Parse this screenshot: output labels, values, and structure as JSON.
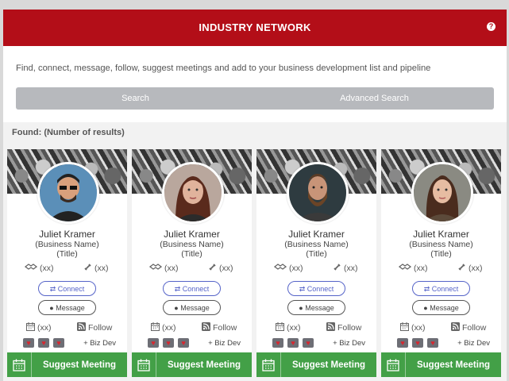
{
  "header": {
    "title": "INDUSTRY NETWORK"
  },
  "intro": {
    "description": "Find, connect, message, follow, suggest meetings and add to your business development list and pipeline",
    "search_label": "Search",
    "advanced_search_label": "Advanced Search"
  },
  "results": {
    "found_label": "Found: (Number of results)"
  },
  "cards": [
    {
      "name": "Juliet Kramer",
      "business": "(Business Name)",
      "title": "(Title)",
      "handshake_count": "(xx)",
      "link_count": "(xx)",
      "connect_label": "Connect",
      "message_label": "Message",
      "calendar_count": "(xx)",
      "follow_label": "Follow",
      "bizdev_label": "+ Biz Dev",
      "suggest_label": "Suggest Meeting"
    },
    {
      "name": "Juliet Kramer",
      "business": "(Business Name)",
      "title": "(Title)",
      "handshake_count": "(xx)",
      "link_count": "(xx)",
      "connect_label": "Connect",
      "message_label": "Message",
      "calendar_count": "(xx)",
      "follow_label": "Follow",
      "bizdev_label": "+ Biz Dev",
      "suggest_label": "Suggest Meeting"
    },
    {
      "name": "Juliet Kramer",
      "business": "(Business Name)",
      "title": "(Title)",
      "handshake_count": "(xx)",
      "link_count": "(xx)",
      "connect_label": "Connect",
      "message_label": "Message",
      "calendar_count": "(xx)",
      "follow_label": "Follow",
      "bizdev_label": "+ Biz Dev",
      "suggest_label": "Suggest Meeting"
    },
    {
      "name": "Juliet Kramer",
      "business": "(Business Name)",
      "title": "(Title)",
      "handshake_count": "(xx)",
      "link_count": "(xx)",
      "connect_label": "Connect",
      "message_label": "Message",
      "calendar_count": "(xx)",
      "follow_label": "Follow",
      "bizdev_label": "+ Biz Dev",
      "suggest_label": "Suggest Meeting"
    }
  ],
  "icons": {
    "help": "question-icon",
    "handshake": "handshake-icon",
    "link": "link-icon",
    "message": "chat-icon",
    "calendar": "calendar-icon",
    "follow": "rss-icon",
    "heart": "heart-icon"
  },
  "colors": {
    "header": "#b30e18",
    "suggest": "#43a047",
    "connect": "#5563c8",
    "search_bar": "#b7b9bd"
  }
}
